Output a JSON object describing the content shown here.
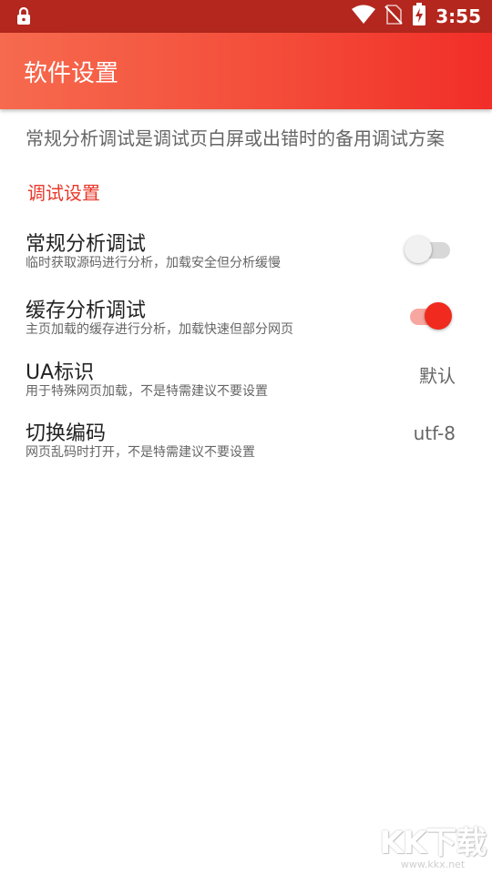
{
  "status_bar": {
    "time": "3:55",
    "icons": [
      "lock-icon",
      "wifi-icon",
      "no-sim-icon",
      "battery-charging-icon"
    ]
  },
  "app_bar": {
    "title": "软件设置"
  },
  "intro": "常规分析调试是调试页白屏或出错时的备用调试方案",
  "section": {
    "title": "调试设置"
  },
  "preferences": [
    {
      "title": "常规分析调试",
      "summary": "临时获取源码进行分析，加载安全但分析缓慢",
      "switch_on": false
    },
    {
      "title": "缓存分析调试",
      "summary": "主页加载的缓存进行分析，加载快速但部分网页",
      "switch_on": true
    },
    {
      "title": "UA标识",
      "summary": "用于特殊网页加载，不是特需建议不要设置",
      "value": "默认"
    },
    {
      "title": "切换编码",
      "summary": "网页乱码时打开，不是特需建议不要设置",
      "value": "utf-8"
    }
  ],
  "watermark": {
    "logo": "KK下载",
    "url": "www.kkx.net"
  },
  "colors": {
    "accent": "#f12e28",
    "status_bar": "#b3271e",
    "section_title": "#e8382a"
  }
}
